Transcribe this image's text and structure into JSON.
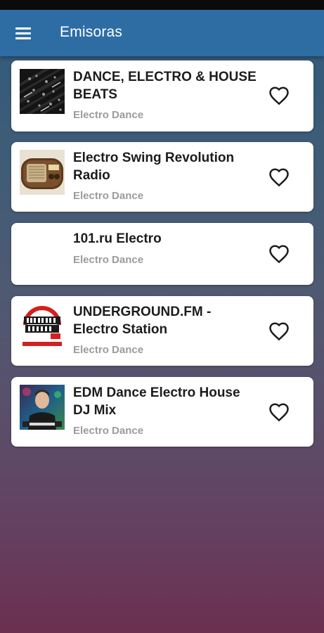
{
  "app_bar": {
    "title": "Emisoras",
    "menu_icon": "hamburger-menu-icon",
    "background": "#2e6da4"
  },
  "stations": [
    {
      "name": "DANCE, ELECTRO & HOUSE BEATS",
      "genre": "Electro Dance",
      "logo": "dj-mixer-logo",
      "favorite_icon": "heart-outline-icon"
    },
    {
      "name": "Electro Swing Revolution Radio",
      "genre": "Electro Dance",
      "logo": "vintage-radio-logo",
      "favorite_icon": "heart-outline-icon"
    },
    {
      "name": "101.ru Electro",
      "genre": "Electro Dance",
      "logo": "",
      "favorite_icon": "heart-outline-icon"
    },
    {
      "name": "UNDERGROUND.FM - Electro Station",
      "genre": "Electro Dance",
      "logo": "underground-fm-logo",
      "favorite_icon": "heart-outline-icon"
    },
    {
      "name": "EDM Dance Electro House DJ Mix",
      "genre": "Electro Dance",
      "logo": "dj-portrait-logo",
      "favorite_icon": "heart-outline-icon"
    }
  ]
}
